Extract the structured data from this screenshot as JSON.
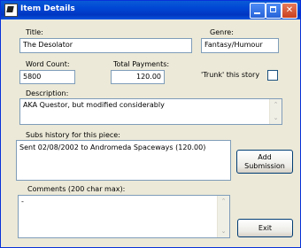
{
  "window": {
    "title": "Item Details"
  },
  "form": {
    "title_label": "Title:",
    "title_value": "The Desolator",
    "genre_label": "Genre:",
    "genre_value": "Fantasy/Humour",
    "word_count_label": "Word Count:",
    "word_count_value": "5800",
    "total_payments_label": "Total Payments:",
    "total_payments_value": "120.00",
    "trunk_label": "'Trunk' this story",
    "trunk_checked": false,
    "description_label": "Description:",
    "description_value": "AKA Questor, but modified considerably",
    "subs_label": "Subs history for this piece:",
    "subs_items": [
      "Sent 02/08/2002 to Andromeda Spaceways (120.00)"
    ],
    "comments_label": "Comments (200 char max):",
    "comments_value": "-"
  },
  "buttons": {
    "add_submission_line1": "Add",
    "add_submission_line2": "Submission",
    "exit": "Exit"
  }
}
